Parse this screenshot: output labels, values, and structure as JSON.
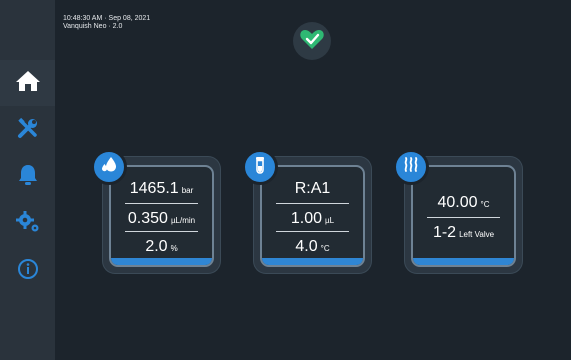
{
  "header": {
    "timestamp": "10:48:30 AM · Sep 08, 2021",
    "device": "Vanquish Neo · 2.0",
    "status_icon": "heart-check-icon",
    "status_color": "#2eb873"
  },
  "sidebar": {
    "items": [
      {
        "name": "home",
        "icon": "home-icon",
        "active": true
      },
      {
        "name": "tools",
        "icon": "tools-icon"
      },
      {
        "name": "alerts",
        "icon": "bell-icon"
      },
      {
        "name": "settings",
        "icon": "gears-icon"
      },
      {
        "name": "info",
        "icon": "info-icon"
      }
    ],
    "icon_colors": {
      "home": "#ffffff",
      "others": "#2a86d8"
    }
  },
  "cards": {
    "pump": {
      "icon": "drops-icon",
      "pressure": {
        "value": "1465.1",
        "unit": "bar"
      },
      "flow": {
        "value": "0.350",
        "unit": "µL/min"
      },
      "composition": {
        "value": "2.0",
        "unit": "%"
      }
    },
    "autosampler": {
      "icon": "vial-icon",
      "position": {
        "value": "R:A1"
      },
      "volume": {
        "value": "1.00",
        "unit": "µL"
      },
      "temperature": {
        "value": "4.0",
        "unit": "°C"
      }
    },
    "column": {
      "icon": "heat-icon",
      "temperature": {
        "value": "40.00",
        "unit": "°C"
      },
      "valve": {
        "value": "1-2",
        "unit": "Left Valve"
      }
    }
  },
  "colors": {
    "accent": "#2a86d8",
    "background": "#1c242c",
    "sidebar": "#2a333c"
  }
}
